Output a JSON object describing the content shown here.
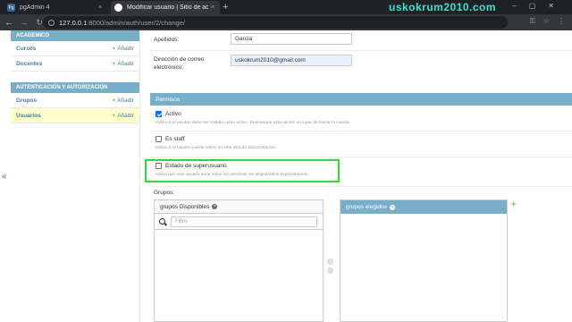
{
  "browser": {
    "tabs": [
      {
        "title": "pgAdmin 4",
        "favicon": "pgadmin-icon"
      },
      {
        "title": "Modificar usuario | Sitio de administración",
        "favicon": "globe-icon"
      }
    ],
    "new_tab": "+",
    "close": "×",
    "url_host": "127.0.0.1",
    "url_path": ":8000/admin/auth/user/2/change/",
    "watermark": "uskokrum2010.com"
  },
  "sidebar": {
    "collapse_symbol": "«",
    "modules": [
      {
        "caption": "ACADEMICO",
        "rows": [
          {
            "label": "Cursos",
            "add": "Añadir"
          },
          {
            "label": "Docentes",
            "add": "Añadir"
          }
        ]
      },
      {
        "caption": "AUTENTICACIÓN Y AUTORIZACIÓN",
        "rows": [
          {
            "label": "Grupos",
            "add": "Añadir"
          },
          {
            "label": "Usuarios",
            "add": "Añadir"
          }
        ]
      }
    ]
  },
  "form": {
    "last_name": {
      "label": "Apellidos:",
      "value": "Garcia"
    },
    "email": {
      "label": "Dirección de correo electrónico:",
      "value": "uskokrum2010@gmail.com"
    },
    "permisos": {
      "caption": "Permisos",
      "activo": {
        "label": "Activo",
        "checked": true,
        "help": "Indica si el usuario debe ser tratado como activo. Desmarque esta opción en lugar de borrar la cuenta."
      },
      "staff": {
        "label": "Es staff",
        "checked": false,
        "help": "Indica si el usuario puede entrar en este sitio de administración."
      },
      "superuser": {
        "label": "Estado de superusuario",
        "checked": false,
        "help": "Indica que este usuario tiene todos los permisos sin asignárselos explícitamente."
      }
    },
    "groups": {
      "label": "Grupos:",
      "available_title": "grupos Disponibles",
      "filter_placeholder": "Filtro",
      "chosen_title": "grupos elegidos",
      "help_glyph": "?"
    }
  },
  "colors": {
    "module_header": "#79aec8",
    "link": "#447e9b",
    "add_plus": "#70bf2b",
    "highlight_border": "#35d43a",
    "active_row": "#ffffcc"
  }
}
